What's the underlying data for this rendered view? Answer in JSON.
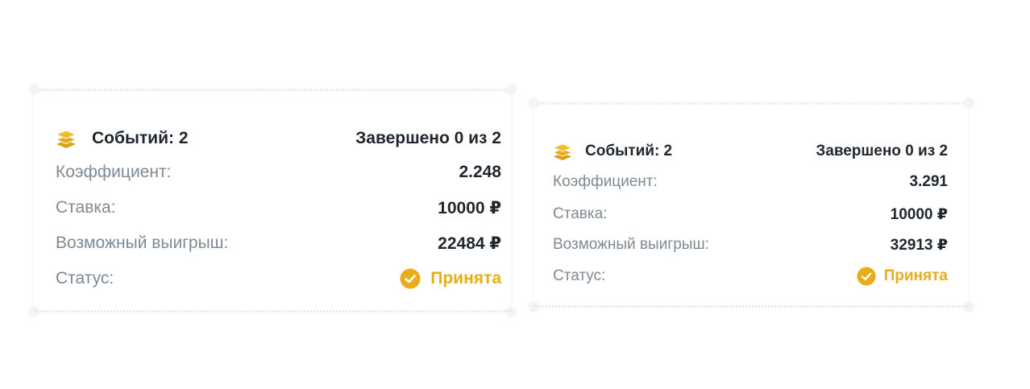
{
  "colors": {
    "accent": "#e7ae18",
    "text_dark": "#1f262d",
    "text_muted": "#7e8a94"
  },
  "tickets": [
    {
      "events_label": "Событий: 2",
      "completed_label": "Завершено 0 из 2",
      "coef_label": "Коэффициент:",
      "coef_value": "2.248",
      "stake_label": "Ставка:",
      "stake_value": "10000 ₽",
      "win_label": "Возможный выигрыш:",
      "win_value": "22484 ₽",
      "status_label": "Статус:",
      "status_value": "Принята",
      "icons": {
        "events": "layers-icon",
        "status": "check-circle-icon"
      }
    },
    {
      "events_label": "Событий: 2",
      "completed_label": "Завершено 0 из 2",
      "coef_label": "Коэффициент:",
      "coef_value": "3.291",
      "stake_label": "Ставка:",
      "stake_value": "10000 ₽",
      "win_label": "Возможный выигрыш:",
      "win_value": "32913 ₽",
      "status_label": "Статус:",
      "status_value": "Принята",
      "icons": {
        "events": "layers-icon",
        "status": "check-circle-icon"
      }
    }
  ]
}
